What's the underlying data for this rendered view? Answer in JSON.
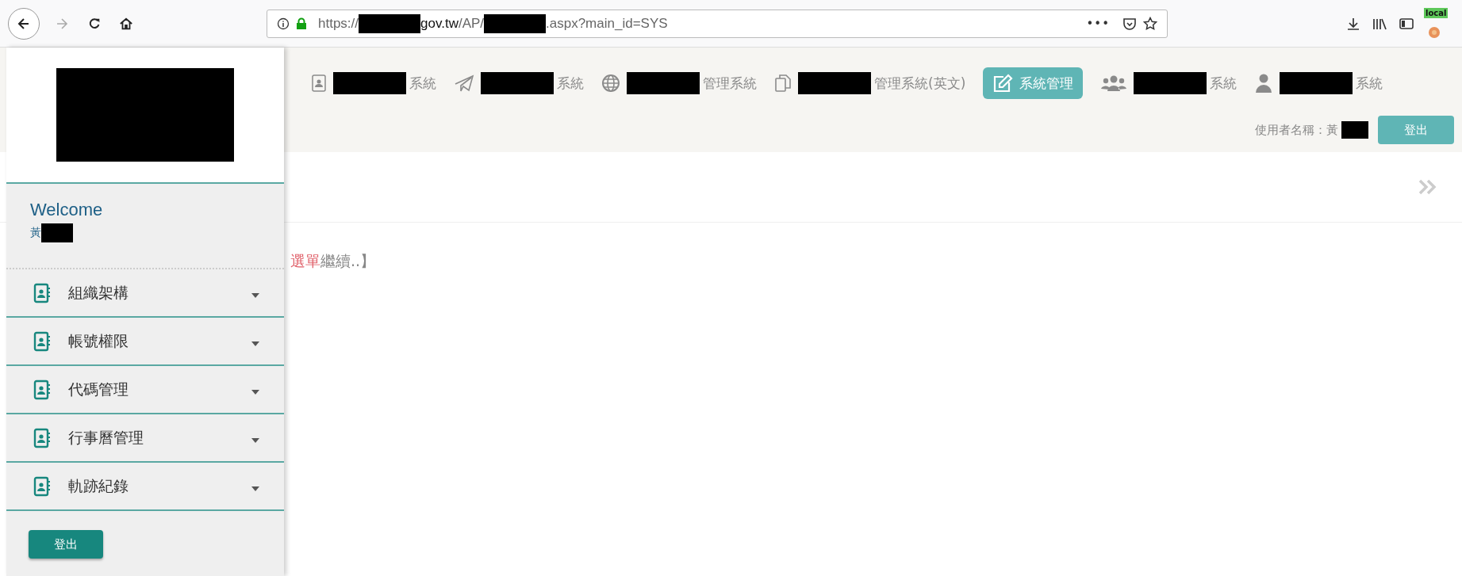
{
  "browser": {
    "back_enabled": true,
    "forward_enabled": false,
    "url_parts": [
      {
        "kind": "text",
        "text": "https://"
      },
      {
        "kind": "redacted"
      },
      {
        "kind": "domain",
        "text": "gov.tw"
      },
      {
        "kind": "text",
        "text": "/AP/"
      },
      {
        "kind": "redacted"
      },
      {
        "kind": "text",
        "text": ".aspx?main_id=SYS"
      }
    ],
    "page_actions": "•••",
    "extension_badge": "local"
  },
  "nav_items": [
    {
      "redacted": true,
      "label": "系統",
      "selected": false
    },
    {
      "redacted": true,
      "label": "系統",
      "selected": false
    },
    {
      "redacted": true,
      "label": "管理系統",
      "selected": false
    },
    {
      "redacted": true,
      "label": "管理系統(英文)",
      "selected": false
    },
    {
      "redacted": false,
      "label": "系統管理",
      "selected": true
    },
    {
      "redacted": true,
      "label": "系統",
      "selected": false
    },
    {
      "redacted": true,
      "label": "系統",
      "selected": false
    }
  ],
  "user_bar": {
    "label": "使用者名稱：黃",
    "logout": "登出"
  },
  "notice": {
    "highlight": "選單",
    "rest": "繼續..】"
  },
  "sidebar": {
    "welcome": "Welcome",
    "user_name": "黃",
    "menu": [
      {
        "label": "組織架構",
        "expanded": false
      },
      {
        "label": "帳號權限",
        "expanded": false
      },
      {
        "label": "代碼管理",
        "expanded": false
      },
      {
        "label": "行事曆管理",
        "expanded": false
      },
      {
        "label": "軌跡紀錄",
        "expanded": false
      }
    ],
    "logout": "登出"
  }
}
